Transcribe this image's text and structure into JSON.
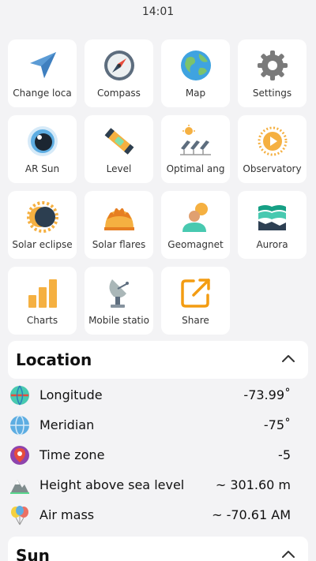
{
  "status_bar": {
    "time": "14:01"
  },
  "tiles": [
    {
      "label": "Change loca",
      "icon": "location-arrow-icon"
    },
    {
      "label": "Compass",
      "icon": "compass-icon"
    },
    {
      "label": "Map",
      "icon": "globe-icon"
    },
    {
      "label": "Settings",
      "icon": "gear-icon"
    },
    {
      "label": "AR Sun",
      "icon": "eye-icon"
    },
    {
      "label": "Level",
      "icon": "level-icon"
    },
    {
      "label": "Optimal ang",
      "icon": "solar-panel-icon"
    },
    {
      "label": "Observatory",
      "icon": "sun-icon"
    },
    {
      "label": "Solar eclipse",
      "icon": "eclipse-icon"
    },
    {
      "label": "Solar flares",
      "icon": "flare-icon"
    },
    {
      "label": "Geomagnet",
      "icon": "geomagnetic-icon"
    },
    {
      "label": "Aurora",
      "icon": "aurora-icon"
    },
    {
      "label": "Charts",
      "icon": "bar-chart-icon"
    },
    {
      "label": "Mobile statio",
      "icon": "satellite-dish-icon"
    },
    {
      "label": "Share",
      "icon": "share-icon"
    }
  ],
  "location": {
    "title": "Location",
    "rows": [
      {
        "label": "Longitude",
        "value": "-73.99˚",
        "icon": "longitude-icon"
      },
      {
        "label": "Meridian",
        "value": "-75˚",
        "icon": "meridian-globe-icon"
      },
      {
        "label": "Time zone",
        "value": "-5",
        "icon": "timezone-pin-icon"
      },
      {
        "label": "Height above sea level",
        "value": "~ 301.60 m",
        "icon": "mountain-icon"
      },
      {
        "label": "Air mass",
        "value": "~ -70.61 AM",
        "icon": "balloons-icon"
      }
    ]
  },
  "sun": {
    "title": "Sun"
  },
  "colors": {
    "background": "#f3f3f5",
    "card": "#ffffff",
    "accent_orange": "#f5a623"
  }
}
